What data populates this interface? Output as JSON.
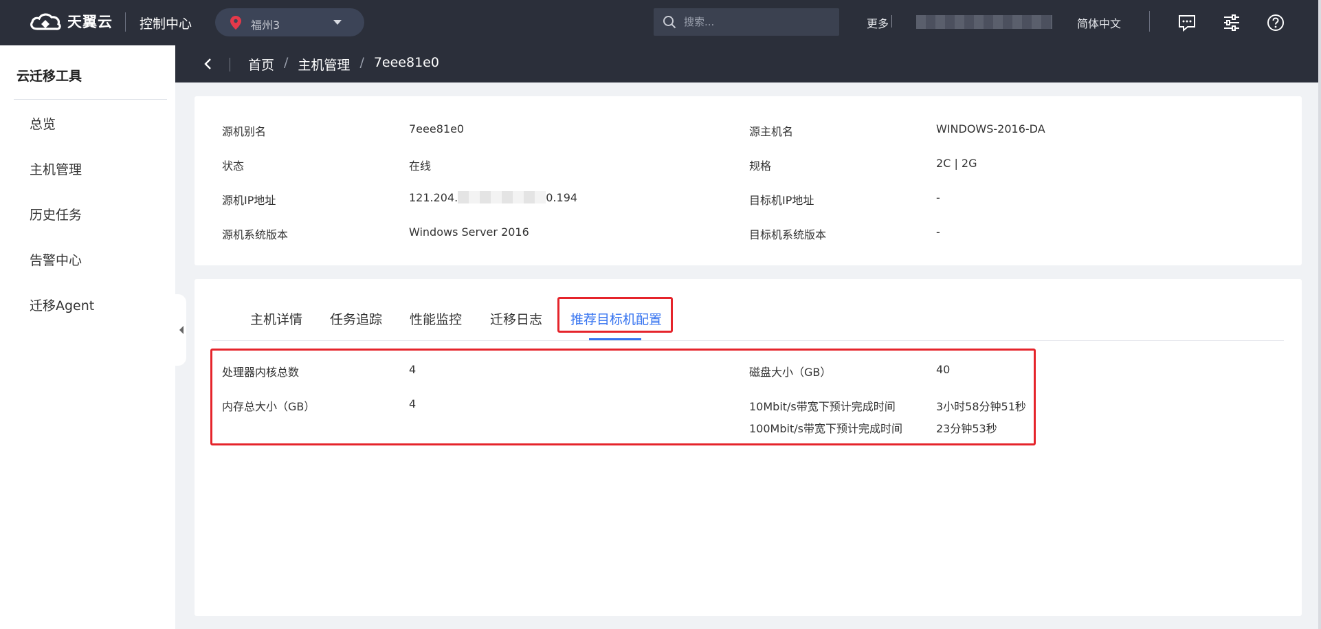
{
  "topbar": {
    "brand": "天翼云",
    "console": "控制中心",
    "region": "福州3",
    "search_placeholder": "搜索...",
    "more": "更多",
    "language": "简体中文"
  },
  "breadcrumb": {
    "home": "首页",
    "host_mgmt": "主机管理",
    "current": "7eee81e0",
    "separator": "/"
  },
  "sidebar": {
    "title": "云迁移工具",
    "items": [
      {
        "label": "总览"
      },
      {
        "label": "主机管理"
      },
      {
        "label": "历史任务"
      },
      {
        "label": "告警中心"
      },
      {
        "label": "迁移Agent"
      }
    ]
  },
  "host_info": {
    "alias_label": "源机别名",
    "alias": "7eee81e0",
    "hostname_label": "源主机名",
    "hostname": "WINDOWS-2016-DA",
    "status_label": "状态",
    "status": "在线",
    "spec_label": "规格",
    "spec": "2C | 2G",
    "src_ip_label": "源机IP地址",
    "src_ip_prefix": "121.204.",
    "src_ip_suffix": "0.194",
    "dst_ip_label": "目标机IP地址",
    "dst_ip": "-",
    "src_os_label": "源机系统版本",
    "src_os": "Windows Server 2016",
    "dst_os_label": "目标机系统版本",
    "dst_os": "-"
  },
  "tabs": [
    {
      "label": "主机详情"
    },
    {
      "label": "任务追踪"
    },
    {
      "label": "性能监控"
    },
    {
      "label": "迁移日志"
    },
    {
      "label": "推荐目标机配置",
      "active": true
    }
  ],
  "recommend": {
    "cpu_label": "处理器内核总数",
    "cpu": "4",
    "disk_label": "磁盘大小（GB）",
    "disk": "40",
    "mem_label": "内存总大小（GB）",
    "mem": "4",
    "time10_label": "10Mbit/s带宽下预计完成时间",
    "time10": "3小时58分钟51秒",
    "time100_label": "100Mbit/s带宽下预计完成时间",
    "time100": "23分钟53秒"
  },
  "colors": {
    "topbar": "#2b2f3a",
    "accent": "#3573f0",
    "highlight": "#e5242b"
  }
}
